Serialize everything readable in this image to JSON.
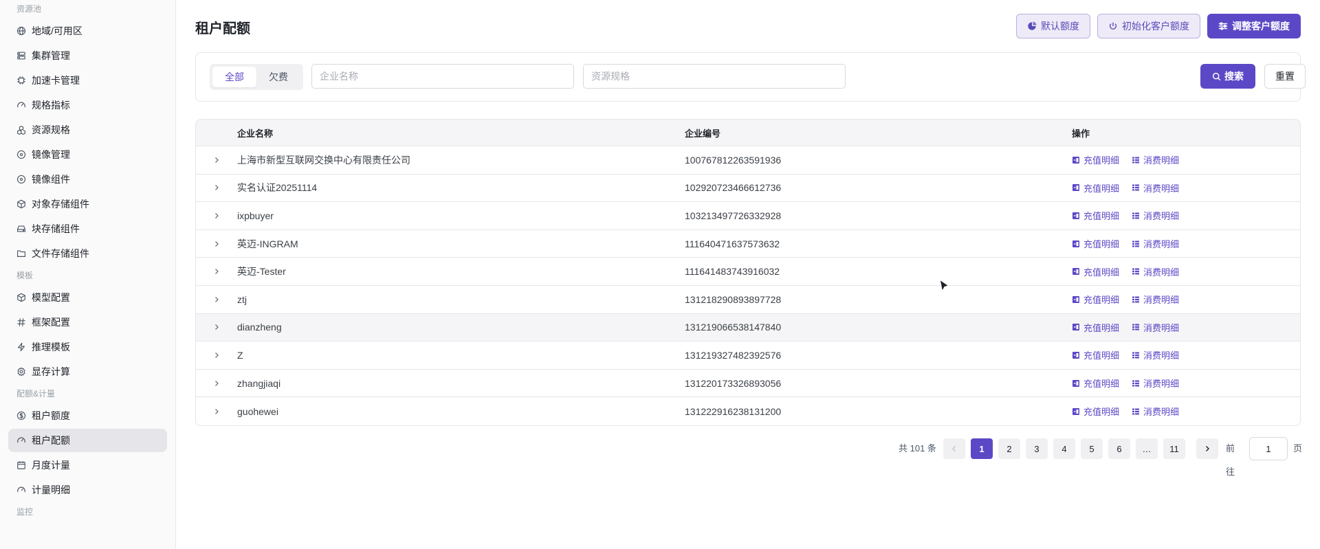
{
  "sidebar": {
    "groups": [
      {
        "title": "资源池",
        "items": [
          {
            "label": "地域/可用区",
            "icon": "globe-icon"
          },
          {
            "label": "集群管理",
            "icon": "server-icon"
          },
          {
            "label": "加速卡管理",
            "icon": "chip-icon"
          },
          {
            "label": "规格指标",
            "icon": "gauge-icon"
          },
          {
            "label": "资源规格",
            "icon": "boxes-icon"
          },
          {
            "label": "镜像管理",
            "icon": "disc-icon"
          },
          {
            "label": "镜像组件",
            "icon": "disc-icon"
          },
          {
            "label": "对象存储组件",
            "icon": "cube-icon"
          },
          {
            "label": "块存储组件",
            "icon": "hard-drive-icon"
          },
          {
            "label": "文件存储组件",
            "icon": "folder-icon"
          }
        ]
      },
      {
        "title": "模板",
        "items": [
          {
            "label": "模型配置",
            "icon": "cube-icon"
          },
          {
            "label": "框架配置",
            "icon": "hash-icon"
          },
          {
            "label": "推理模板",
            "icon": "zap-icon"
          },
          {
            "label": "显存计算",
            "icon": "gear-icon"
          }
        ]
      },
      {
        "title": "配额&计量",
        "items": [
          {
            "label": "租户额度",
            "icon": "dollar-circle-icon"
          },
          {
            "label": "租户配额",
            "icon": "gauge-icon",
            "active": true
          },
          {
            "label": "月度计量",
            "icon": "calendar-icon"
          },
          {
            "label": "计量明细",
            "icon": "gauge-icon"
          }
        ]
      },
      {
        "title": "监控",
        "items": []
      }
    ]
  },
  "header": {
    "title": "租户配额",
    "buttons": {
      "default_quota": "默认额度",
      "init_quota": "初始化客户额度",
      "adjust_quota": "调整客户额度"
    }
  },
  "filter": {
    "tabs": [
      {
        "label": "全部",
        "active": true
      },
      {
        "label": "欠费",
        "active": false
      }
    ],
    "company_placeholder": "企业名称",
    "spec_placeholder": "资源规格",
    "search_label": "搜索",
    "reset_label": "重置"
  },
  "table": {
    "headers": {
      "name": "企业名称",
      "id": "企业编号",
      "ops": "操作"
    },
    "op_labels": {
      "recharge": "充值明细",
      "consume": "消费明细"
    },
    "rows": [
      {
        "name": "上海市新型互联网交换中心有限责任公司",
        "id": "100767812263591936"
      },
      {
        "name": "实名认证20251114",
        "id": "102920723466612736"
      },
      {
        "name": "ixpbuyer",
        "id": "103213497726332928"
      },
      {
        "name": "英迈-INGRAM",
        "id": "111640471637573632"
      },
      {
        "name": "英迈-Tester",
        "id": "111641483743916032"
      },
      {
        "name": "ztj",
        "id": "131218290893897728"
      },
      {
        "name": "dianzheng",
        "id": "131219066538147840",
        "hover": true
      },
      {
        "name": "Z",
        "id": "131219327482392576"
      },
      {
        "name": "zhangjiaqi",
        "id": "131220173326893056"
      },
      {
        "name": "guohewei",
        "id": "131222916238131200"
      }
    ]
  },
  "pagination": {
    "total_text": "共 101 条",
    "pages": [
      "1",
      "2",
      "3",
      "4",
      "5",
      "6",
      "…",
      "11"
    ],
    "current": "1",
    "goto_label": "前往",
    "goto_value": "1",
    "page_suffix": "页"
  },
  "colors": {
    "accent": "#5b48c6",
    "accent_light": "#eeeaf8"
  }
}
